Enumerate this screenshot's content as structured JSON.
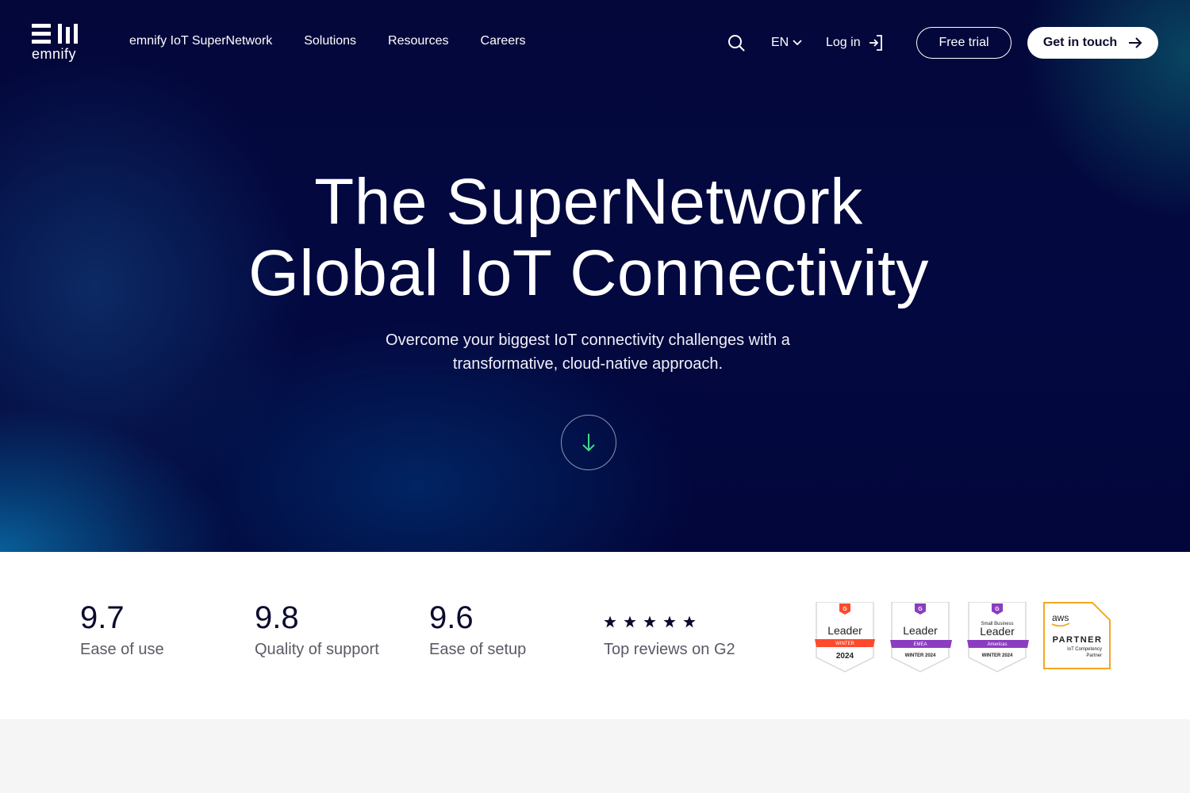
{
  "header": {
    "logo_text": "emnify",
    "nav": [
      "emnify IoT SuperNetwork",
      "Solutions",
      "Resources",
      "Careers"
    ],
    "language": "EN",
    "login_label": "Log in",
    "free_trial_label": "Free trial",
    "contact_label": "Get in touch"
  },
  "hero": {
    "title_line1": "The SuperNetwork",
    "title_line2": "Global IoT Connectivity",
    "subtitle_line1": "Overcome your biggest IoT connectivity challenges with a",
    "subtitle_line2": "transformative, cloud-native approach."
  },
  "ratings": [
    {
      "value": "9.7",
      "label": "Ease of use"
    },
    {
      "value": "9.8",
      "label": "Quality of support"
    },
    {
      "value": "9.6",
      "label": "Ease of setup"
    }
  ],
  "reviews": {
    "stars": 5,
    "label": "Top reviews on G2"
  },
  "badges": [
    {
      "top": "",
      "title": "Leader",
      "band": "WINTER",
      "bottom": "2024",
      "band_color": "#ff492c"
    },
    {
      "top": "",
      "title": "Leader",
      "band": "EMEA",
      "bottom": "WINTER 2024",
      "band_color": "#8b3dc0"
    },
    {
      "top": "Small Business",
      "title": "Leader",
      "band": "Americas",
      "bottom": "WINTER 2024",
      "band_color": "#8b3dc0"
    },
    {
      "top": "aws",
      "title": "PARTNER",
      "band": "IoT Competency",
      "bottom": "Partner",
      "band_color": "#f5a623"
    }
  ],
  "colors": {
    "hero_bg": "#03073a",
    "accent_green": "#3ddc84",
    "text_dark": "#0b0b2e"
  }
}
